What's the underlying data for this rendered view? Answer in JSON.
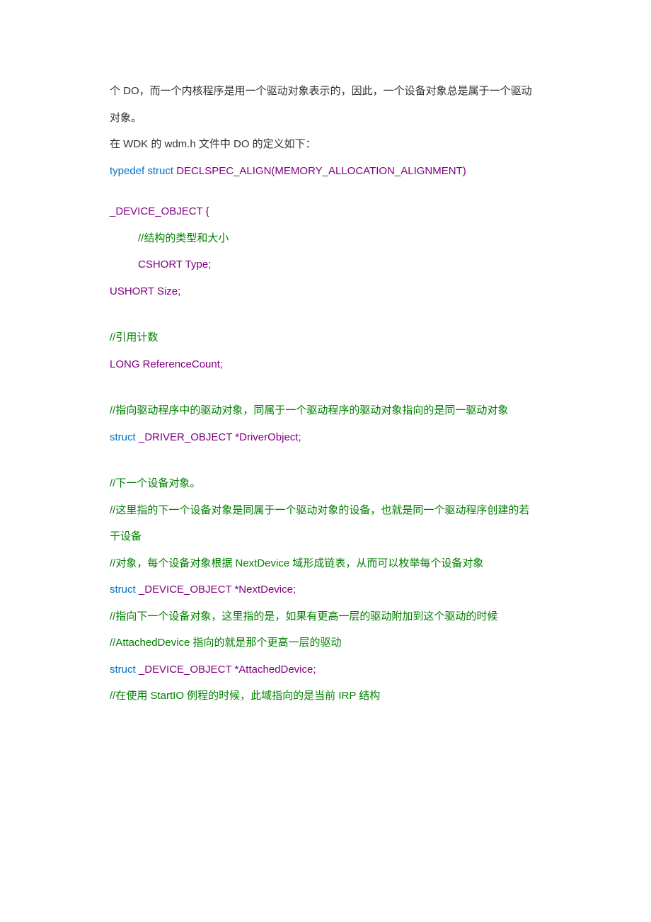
{
  "lines": [
    {
      "cls": "line",
      "segments": [
        {
          "text": "个 DO，而一个内核程序是用一个驱动对象表示的，因此，一个设备对象总是属于一个驱动",
          "cls": "color-black"
        }
      ]
    },
    {
      "cls": "line",
      "segments": [
        {
          "text": "对象。",
          "cls": "color-black"
        }
      ]
    },
    {
      "cls": "line",
      "segments": [
        {
          "text": "在 WDK 的 wdm.h 文件中 DO 的定义如下：",
          "cls": "color-black"
        }
      ]
    },
    {
      "cls": "line",
      "segments": [
        {
          "text": "typedef  struct",
          "cls": "color-blue"
        },
        {
          "text": "  DECLSPEC_ALIGN(MEMORY_ALLOCATION_ALIGNMENT)",
          "cls": "color-purple"
        }
      ]
    },
    {
      "cls": "line spacer",
      "segments": []
    },
    {
      "cls": "line",
      "segments": [
        {
          "text": "_DEVICE_OBJECT  {",
          "cls": "color-purple"
        }
      ]
    },
    {
      "cls": "line indented",
      "segments": [
        {
          "text": "//结构的类型和大小",
          "cls": "color-green"
        }
      ]
    },
    {
      "cls": "line indented",
      "segments": [
        {
          "text": " CSHORT  Type;",
          "cls": "color-purple"
        }
      ]
    },
    {
      "cls": "line",
      "segments": [
        {
          "text": "USHORT  Size;",
          "cls": "color-purple"
        }
      ]
    },
    {
      "cls": "line spacer-lg",
      "segments": []
    },
    {
      "cls": "line",
      "segments": [
        {
          "text": "//引用计数",
          "cls": "color-green"
        }
      ]
    },
    {
      "cls": "line",
      "segments": [
        {
          "text": "LONG  ReferenceCount;",
          "cls": "color-purple"
        }
      ]
    },
    {
      "cls": "line spacer-lg",
      "segments": []
    },
    {
      "cls": "line",
      "segments": [
        {
          "text": "//指向驱动程序中的驱动对象，同属于一个驱动程序的驱动对象指向的是同一驱动对象",
          "cls": "color-green"
        }
      ]
    },
    {
      "cls": "line",
      "segments": [
        {
          "text": "struct",
          "cls": "color-blue"
        },
        {
          "text": "  _DRIVER_OBJECT *DriverObject;",
          "cls": "color-purple"
        }
      ]
    },
    {
      "cls": "line spacer-lg",
      "segments": []
    },
    {
      "cls": "line",
      "segments": [
        {
          "text": "//下一个设备对象。",
          "cls": "color-green"
        }
      ]
    },
    {
      "cls": "line",
      "segments": [
        {
          "text": "//这里指的下一个设备对象是同属于一个驱动对象的设备，也就是同一个驱动程序创建的若",
          "cls": "color-green"
        }
      ]
    },
    {
      "cls": "line",
      "segments": [
        {
          "text": "干设备",
          "cls": "color-green"
        }
      ]
    },
    {
      "cls": "line",
      "segments": [
        {
          "text": "//对象，每个设备对象根据 NextDevice 域形成链表，从而可以枚举每个设备对象",
          "cls": "color-green"
        }
      ]
    },
    {
      "cls": "line",
      "segments": [
        {
          "text": "struct",
          "cls": "color-blue"
        },
        {
          "text": "  _DEVICE_OBJECT  *NextDevice;",
          "cls": "color-purple"
        }
      ]
    },
    {
      "cls": "line",
      "segments": [
        {
          "text": "//指向下一个设备对象，这里指的是，如果有更高一层的驱动附加到这个驱动的时候",
          "cls": "color-green"
        }
      ]
    },
    {
      "cls": "line",
      "segments": [
        {
          "text": "//AttachedDevice 指向的就是那个更高一层的驱动",
          "cls": "color-green"
        }
      ]
    },
    {
      "cls": "line",
      "segments": [
        {
          "text": "struct",
          "cls": "color-blue"
        },
        {
          "text": "  _DEVICE_OBJECT  *AttachedDevice;",
          "cls": "color-purple"
        }
      ]
    },
    {
      "cls": "line",
      "segments": [
        {
          "text": "//在使用 StartIO 例程的时候，此域指向的是当前 IRP 结构",
          "cls": "color-green"
        }
      ]
    }
  ]
}
